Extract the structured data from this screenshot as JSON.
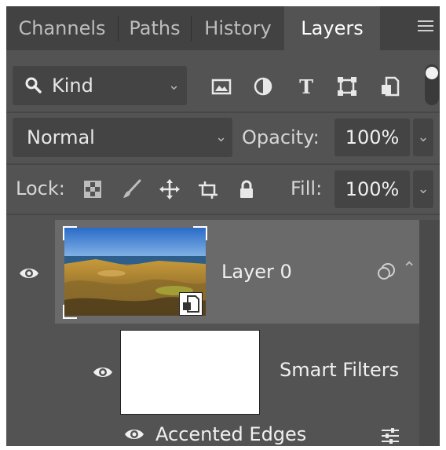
{
  "tabs": [
    {
      "label": "Channels",
      "active": false
    },
    {
      "label": "Paths",
      "active": false
    },
    {
      "label": "History",
      "active": false
    },
    {
      "label": "Layers",
      "active": true
    }
  ],
  "icons": {
    "panel_menu": "hamburger-menu-icon",
    "search": "search-icon",
    "filters": [
      "image-filter-icon",
      "adjustment-filter-icon",
      "type-filter-icon",
      "shape-filter-icon",
      "smart-object-filter-icon"
    ],
    "locks": [
      "lock-transparent-pixels-icon",
      "lock-image-pixels-icon",
      "lock-position-icon",
      "lock-artboard-icon",
      "lock-all-icon"
    ]
  },
  "filter": {
    "kind_label": "Kind"
  },
  "blend": {
    "mode": "Normal",
    "opacity_label": "Opacity:",
    "opacity_value": "100%"
  },
  "lock": {
    "label": "Lock:",
    "fill_label": "Fill:",
    "fill_value": "100%"
  },
  "layers": [
    {
      "name": "Layer 0",
      "visible": true,
      "selected": true,
      "type": "smart-object"
    },
    {
      "name": "Smart Filters",
      "visible": true,
      "type": "smart-filter-mask"
    },
    {
      "name": "Accented Edges",
      "visible": true,
      "type": "filter"
    }
  ],
  "colors": {
    "panel": "#535353",
    "tab_bar": "#424242",
    "selected_row": "#6a6a6a",
    "field": "#444444"
  }
}
